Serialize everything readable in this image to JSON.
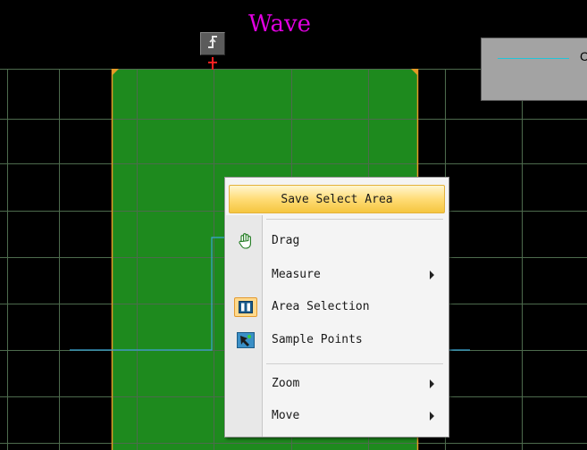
{
  "window": {
    "title": "Wave"
  },
  "colors": {
    "background": "#000000",
    "grid": "#4d6b4d",
    "selection_fill": "#1e8a1e",
    "selection_border": "#e59a27",
    "waveform": "#3aa6d6",
    "title": "#e000e0",
    "trigger_marker": "#ff2020",
    "legend_line": "#22c4d8"
  },
  "toolbar": {
    "trigger_icon": "trigger-edge-icon"
  },
  "legend": {
    "label": "C"
  },
  "context_menu": {
    "top_item": "Save Select Area",
    "items": [
      {
        "label": "Drag",
        "icon": "hand-icon",
        "has_submenu": false,
        "checked": false
      },
      {
        "label": "Measure",
        "icon": "",
        "has_submenu": true,
        "checked": false
      },
      {
        "label": "Area Selection",
        "icon": "area-selection-icon",
        "has_submenu": false,
        "checked": true
      },
      {
        "label": "Sample Points",
        "icon": "sample-points-icon",
        "has_submenu": false,
        "checked": false
      },
      {
        "label": "Zoom",
        "icon": "",
        "has_submenu": true,
        "checked": false
      },
      {
        "label": "Move",
        "icon": "",
        "has_submenu": true,
        "checked": false
      }
    ]
  }
}
